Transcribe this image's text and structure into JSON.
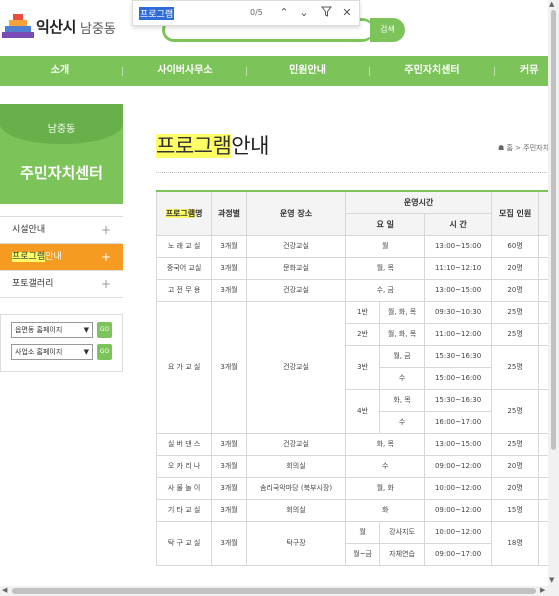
{
  "header": {
    "city": "익산시",
    "dong": "남중동",
    "search_button": "검색"
  },
  "findbar": {
    "query": "프로그램",
    "count": "0/5"
  },
  "nav": {
    "items": [
      "소개",
      "사이버사무소",
      "민원안내",
      "주민자치센터",
      "커뮤"
    ]
  },
  "sidebar": {
    "dong": "남중동",
    "title": "주민자치센터",
    "menu": [
      {
        "label": "시설안내"
      },
      {
        "label_hl": "프로그램",
        "label_rest": "안내"
      },
      {
        "label": "포토갤러리"
      }
    ],
    "select1": "읍면동 홈페이지",
    "select2": "사업소 홈페이지",
    "go": "GO"
  },
  "content": {
    "title_hl": "프로그램",
    "title_rest": "안내",
    "breadcrumb": "홈 > 주민자치"
  },
  "table": {
    "headers": {
      "program_hl": "프로그램",
      "program_rest": "명",
      "course": "과정별",
      "place": "운영 장소",
      "op_time": "운영시간",
      "day": "요 일",
      "time": "시 간",
      "recruit": "모집 인원"
    },
    "rows": {
      "r1": [
        "노 래 교 실",
        "3개월",
        "건강교실",
        "월",
        "13:00~15:00",
        "60명"
      ],
      "r2": [
        "중국어 교실",
        "3개월",
        "문화교실",
        "월, 목",
        "11:10~12:10",
        "20명"
      ],
      "r3": [
        "고 전 무 용",
        "3개월",
        "건강교실",
        "수, 금",
        "13:00~15:00",
        "20명"
      ],
      "yoga": {
        "name": "요 가 교 실",
        "course": "3개월",
        "place": "건강교실",
        "b1": [
          "1반",
          "월, 화, 목",
          "09:30~10:30",
          "25명"
        ],
        "b2": [
          "2반",
          "월, 화, 목",
          "11:00~12:00",
          "25명"
        ],
        "b3": [
          "3반",
          "월, 금",
          "15:30~16:30",
          "수",
          "15:00~16:00",
          "25명"
        ],
        "b4": [
          "4반",
          "화, 목",
          "15:30~16:30",
          "수",
          "16:00~17:00",
          "25명"
        ]
      },
      "r8": [
        "실 버 댄 스",
        "3개월",
        "건강교실",
        "화, 목",
        "13:00~15:00",
        "25명"
      ],
      "r9": [
        "오 카 리 나",
        "3개월",
        "회의실",
        "수",
        "09:00~12:00",
        "20명"
      ],
      "r10": [
        "사 물 놀 이",
        "3개월",
        "솜리국악마당 (북부시장)",
        "월, 화",
        "10:00~12:00",
        "20명"
      ],
      "r11": [
        "기 타 교 실",
        "3개월",
        "회의실",
        "화",
        "09:00~12:00",
        "15명"
      ],
      "takgu": {
        "name": "탁 구 교 실",
        "course": "3개월",
        "place": "탁구장",
        "s1": [
          "월",
          "강사지도",
          "10:00~12:00"
        ],
        "s2": [
          "월~금",
          "자체연습",
          "09:00~17:00"
        ],
        "recruit": "18명"
      }
    }
  },
  "colors": {
    "green": "#7cc35a",
    "orange": "#f59b22",
    "highlight": "#ffff66"
  }
}
